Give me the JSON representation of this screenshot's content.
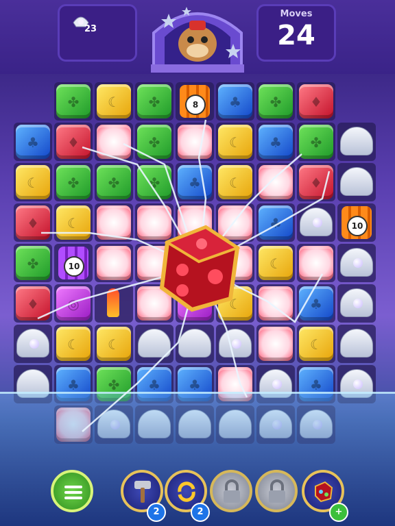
{
  "hud": {
    "goal": {
      "icon": "pearl-shell-icon",
      "count": "23"
    },
    "moves": {
      "label": "Moves",
      "value": "24"
    },
    "mascot": "otter-mascot"
  },
  "board": {
    "rows": [
      [
        "empty",
        "green",
        "yellow",
        "green",
        "tnt-orange",
        "blue",
        "green",
        "red",
        "empty"
      ],
      [
        "blue",
        "red",
        "white",
        "green",
        "white",
        "yellow",
        "blue",
        "green",
        "shell"
      ],
      [
        "yellow",
        "green",
        "green",
        "green",
        "blue",
        "yellow",
        "white",
        "red",
        "shell"
      ],
      [
        "red",
        "yellow",
        "white",
        "white",
        "white",
        "white",
        "blue",
        "shell-pearl",
        "tnt-orange"
      ],
      [
        "green",
        "tnt-purple",
        "white",
        "white",
        "white",
        "white",
        "yellow",
        "white",
        "shell-pearl"
      ],
      [
        "red",
        "purple",
        "rocket",
        "white",
        "purple",
        "yellow",
        "white",
        "blue",
        "shell-pearl"
      ],
      [
        "shell-pearl",
        "yellow",
        "yellow",
        "shell",
        "shell",
        "shell-pearl",
        "white",
        "yellow",
        "shell"
      ],
      [
        "shell",
        "blue",
        "green",
        "blue",
        "blue",
        "white",
        "shell-pearl",
        "blue",
        "shell-pearl"
      ],
      [
        "empty",
        "white",
        "shell-pearl",
        "shell",
        "shell",
        "shell",
        "shell-pearl",
        "shell-pearl",
        "empty"
      ]
    ],
    "tnt_counters": {
      "r0c4": "8",
      "r3c8": "10",
      "r4c1": "10"
    }
  },
  "boosters": [
    {
      "name": "menu-button",
      "icon": "menu-icon"
    },
    {
      "name": "hammer-booster",
      "icon": "hammer-icon",
      "badge": "2"
    },
    {
      "name": "shuffle-booster",
      "icon": "shuffle-icon",
      "badge": "2"
    },
    {
      "name": "locked-slot-1",
      "icon": "lock-icon"
    },
    {
      "name": "locked-slot-2",
      "icon": "lock-icon"
    },
    {
      "name": "dice-booster",
      "icon": "dice-icon",
      "badge": "+"
    }
  ]
}
